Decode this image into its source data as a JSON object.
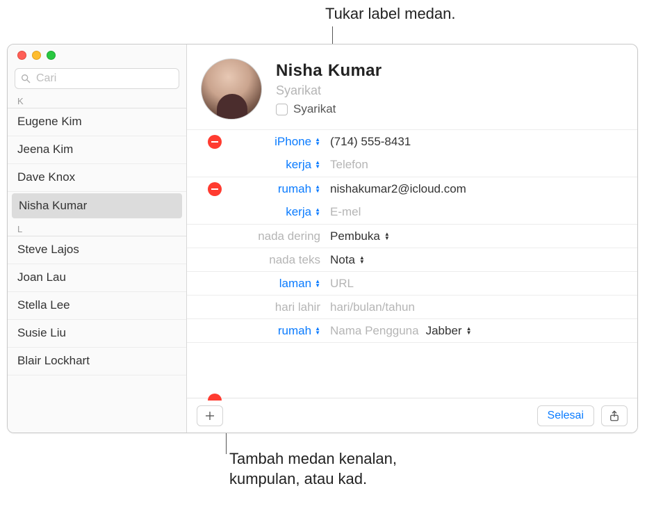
{
  "callouts": {
    "top": "Tukar label medan.",
    "bottom": "Tambah medan kenalan, kumpulan, atau kad."
  },
  "search": {
    "placeholder": "Cari"
  },
  "sections": [
    {
      "letter": "K",
      "items": [
        "Eugene Kim",
        "Jeena Kim",
        "Dave Knox",
        "Nisha Kumar"
      ],
      "selected": "Nisha Kumar"
    },
    {
      "letter": "L",
      "items": [
        "Steve Lajos",
        "Joan Lau",
        "Stella Lee",
        "Susie Liu",
        "Blair Lockhart"
      ],
      "selected": null
    }
  ],
  "card": {
    "first": "Nisha",
    "last": "Kumar",
    "company_placeholder": "Syarikat",
    "company_checkbox_label": "Syarikat"
  },
  "fields": {
    "phone_iphone_label": "iPhone",
    "phone_iphone_value": "(714) 555-8431",
    "phone_work_label": "kerja",
    "phone_work_placeholder": "Telefon",
    "email_home_label": "rumah",
    "email_home_value": "nishakumar2@icloud.com",
    "email_work_label": "kerja",
    "email_work_placeholder": "E-mel",
    "ringtone_label": "nada dering",
    "ringtone_value": "Pembuka",
    "texttone_label": "nada teks",
    "texttone_value": "Nota",
    "homepage_label": "laman",
    "homepage_placeholder": "URL",
    "birthday_label": "hari lahir",
    "birthday_placeholder": "hari/bulan/tahun",
    "im_home_label": "rumah",
    "im_username_placeholder": "Nama Pengguna",
    "im_service_value": "Jabber"
  },
  "footer": {
    "done": "Selesai"
  }
}
